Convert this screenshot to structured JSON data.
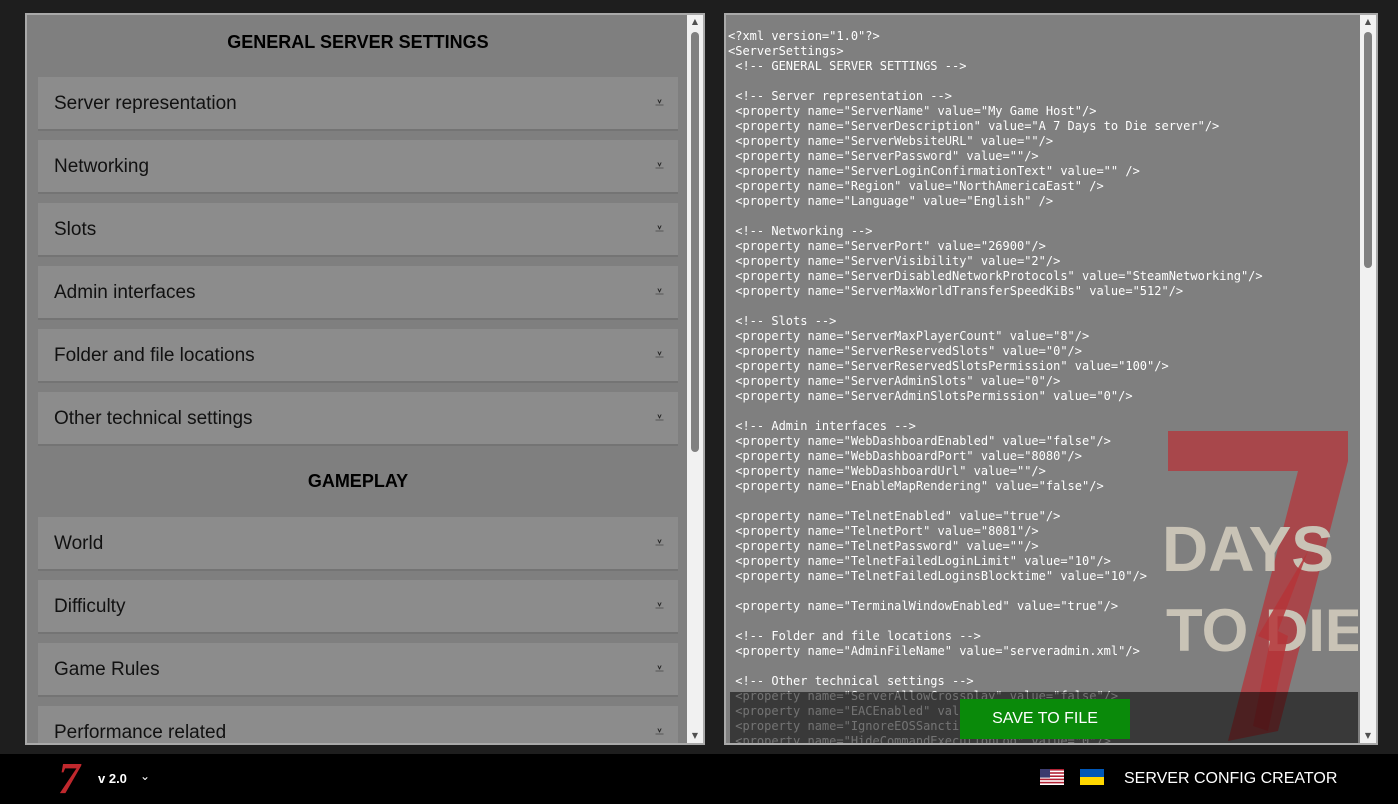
{
  "left": {
    "general_title": "GENERAL SERVER SETTINGS",
    "gameplay_title": "GAMEPLAY",
    "general_items": [
      {
        "label": "Server representation"
      },
      {
        "label": "Networking"
      },
      {
        "label": "Slots"
      },
      {
        "label": "Admin interfaces"
      },
      {
        "label": "Folder and file locations"
      },
      {
        "label": "Other technical settings"
      }
    ],
    "gameplay_items": [
      {
        "label": "World"
      },
      {
        "label": "Difficulty"
      },
      {
        "label": "Game Rules"
      },
      {
        "label": "Performance related"
      }
    ],
    "expand_icon": "⩡"
  },
  "right": {
    "xml_lines": "<?xml version=\"1.0\"?>\n<ServerSettings>\n <!-- GENERAL SERVER SETTINGS -->\n\n <!-- Server representation -->\n <property name=\"ServerName\" value=\"My Game Host\"/>\n <property name=\"ServerDescription\" value=\"A 7 Days to Die server\"/>\n <property name=\"ServerWebsiteURL\" value=\"\"/>\n <property name=\"ServerPassword\" value=\"\"/>\n <property name=\"ServerLoginConfirmationText\" value=\"\" />\n <property name=\"Region\" value=\"NorthAmericaEast\" />\n <property name=\"Language\" value=\"English\" />\n\n <!-- Networking -->\n <property name=\"ServerPort\" value=\"26900\"/>\n <property name=\"ServerVisibility\" value=\"2\"/>\n <property name=\"ServerDisabledNetworkProtocols\" value=\"SteamNetworking\"/>\n <property name=\"ServerMaxWorldTransferSpeedKiBs\" value=\"512\"/>\n\n <!-- Slots -->\n <property name=\"ServerMaxPlayerCount\" value=\"8\"/>\n <property name=\"ServerReservedSlots\" value=\"0\"/>\n <property name=\"ServerReservedSlotsPermission\" value=\"100\"/>\n <property name=\"ServerAdminSlots\" value=\"0\"/>\n <property name=\"ServerAdminSlotsPermission\" value=\"0\"/>\n\n <!-- Admin interfaces -->\n <property name=\"WebDashboardEnabled\" value=\"false\"/>\n <property name=\"WebDashboardPort\" value=\"8080\"/>\n <property name=\"WebDashboardUrl\" value=\"\"/>\n <property name=\"EnableMapRendering\" value=\"false\"/>\n\n <property name=\"TelnetEnabled\" value=\"true\"/>\n <property name=\"TelnetPort\" value=\"8081\"/>\n <property name=\"TelnetPassword\" value=\"\"/>\n <property name=\"TelnetFailedLoginLimit\" value=\"10\"/>\n <property name=\"TelnetFailedLoginsBlocktime\" value=\"10\"/>\n\n <property name=\"TerminalWindowEnabled\" value=\"true\"/>\n\n <!-- Folder and file locations -->\n <property name=\"AdminFileName\" value=\"serveradmin.xml\"/>\n\n <!-- Other technical settings -->\n <property name=\"ServerAllowCrossplay\" value=\"false\"/>\n <property name=\"EACEnabled\" value=\"true\"/>\n <property name=\"IgnoreEOSSanctions\" value=\"false\"/>\n <property name=\"HideCommandExecutionLog\" value=\"0\"/>",
    "save_label": "SAVE TO FILE",
    "logo_text": {
      "line1": "DAYS",
      "line2": "TO DIE",
      "big7": "7"
    }
  },
  "footer": {
    "brand": "7",
    "version": "v 2.0",
    "title": "SERVER CONFIG CREATOR"
  },
  "colors": {
    "save_button": "#0a8a0a",
    "brand_red": "#c0282d"
  }
}
